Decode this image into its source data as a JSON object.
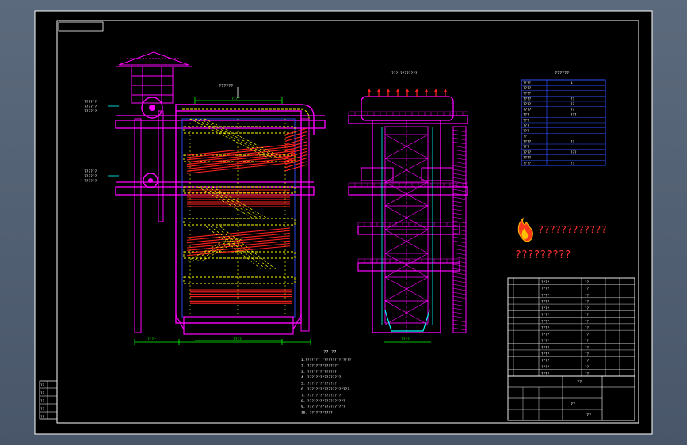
{
  "viewport": {
    "background": "#56657a",
    "sheet": "#000000"
  },
  "colors": {
    "frame": "#ffffff",
    "steel": "#ff00ff",
    "pipe": "#ffff00",
    "heat": "#ff2020",
    "blue": "#3050ff",
    "cyan": "#00ffff",
    "dim": "#00ff00",
    "red_text": "#ff3030"
  },
  "left_callouts": {
    "upper_lines": [
      "??????",
      "??????",
      "??????"
    ],
    "lower_lines": [
      "??????",
      "??????",
      "??????"
    ]
  },
  "front_view": {
    "outlet_label": "??????",
    "top_dim": "????",
    "bottom_dim": "????",
    "bottom_left_dim": "????"
  },
  "side_view": {
    "title": "??? ????????",
    "bottom_dim": "????"
  },
  "tech_table": {
    "title": "??????",
    "rows": [
      {
        "name": "????",
        "value": "1"
      },
      {
        "name": "????",
        "value": ""
      },
      {
        "name": "????",
        "value": ""
      },
      {
        "name": "????",
        "value": "??"
      },
      {
        "name": "????",
        "value": "??"
      },
      {
        "name": "????",
        "value": "??"
      },
      {
        "name": "???",
        "value": "???"
      },
      {
        "name": "???",
        "value": ""
      },
      {
        "name": "???",
        "value": ""
      },
      {
        "name": "???",
        "value": ""
      },
      {
        "name": "??",
        "value": ""
      },
      {
        "name": "????",
        "value": "??"
      },
      {
        "name": "???",
        "value": ""
      },
      {
        "name": "????",
        "value": "???"
      },
      {
        "name": "????",
        "value": ""
      },
      {
        "name": "????",
        "value": "??"
      }
    ]
  },
  "logo": {
    "title": "????????????",
    "subtitle": "?????????"
  },
  "notes": {
    "title": "?? ??",
    "lines": [
      "1.??????? ??????????????",
      "2. ???????????????",
      "3. ??????????????",
      "4. ????????????????",
      "5. ??????????????",
      "6. ????????????????????",
      "7. ????????????????",
      "8. ??????????????????",
      "9. ??????????????????",
      "10. ???????????"
    ]
  },
  "bom": {
    "rows": [
      [
        "",
        "????",
        "??",
        ""
      ],
      [
        "",
        "????",
        "??",
        ""
      ],
      [
        "",
        "????",
        "??",
        ""
      ],
      [
        "",
        "????",
        "??",
        ""
      ],
      [
        "",
        "????",
        "??",
        ""
      ],
      [
        "",
        "????",
        "??",
        ""
      ],
      [
        "",
        "????",
        "??",
        ""
      ],
      [
        "",
        "????",
        "??",
        ""
      ],
      [
        "",
        "????",
        "??",
        ""
      ],
      [
        "",
        "????",
        "??",
        ""
      ],
      [
        "",
        "????",
        "??",
        ""
      ],
      [
        "",
        "????",
        "??",
        ""
      ],
      [
        "",
        "????",
        "??",
        ""
      ],
      [
        "",
        "????",
        "??",
        ""
      ],
      [
        "",
        "????",
        "??",
        ""
      ]
    ],
    "title_block": {
      "drawing": "??",
      "scale": "??",
      "sheet": "??"
    }
  },
  "left_tab": {
    "cells": [
      "??",
      "??",
      "??",
      "??",
      "??"
    ]
  }
}
